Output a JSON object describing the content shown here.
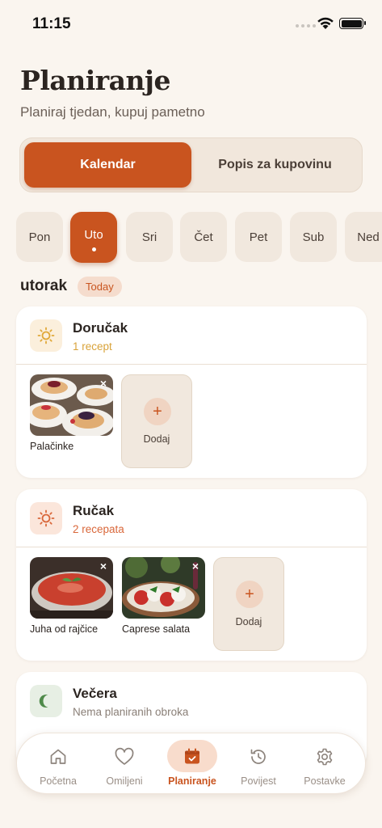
{
  "status_bar": {
    "time": "11:15"
  },
  "header": {
    "title": "Planiranje",
    "subtitle": "Planiraj tjedan, kupuj pametno"
  },
  "segmented": {
    "active": "Kalendar",
    "inactive": "Popis za kupovinu"
  },
  "days": [
    "Pon",
    "Uto",
    "Sri",
    "Čet",
    "Pet",
    "Sub",
    "Ned"
  ],
  "selected_day": {
    "name": "utorak",
    "badge": "Today"
  },
  "meals": {
    "breakfast": {
      "title": "Doručak",
      "count": "1 recept",
      "recipes": [
        "Palačinke"
      ],
      "add_label": "Dodaj"
    },
    "lunch": {
      "title": "Ručak",
      "count": "2 recepata",
      "recipes": [
        "Juha od rajčice",
        "Caprese salata"
      ],
      "add_label": "Dodaj"
    },
    "dinner": {
      "title": "Večera",
      "count": "Nema planiranih obroka"
    }
  },
  "colors": {
    "accent": "#c9541f",
    "background": "#faf5ef",
    "breakfast_count": "#d9a33a",
    "lunch_count": "#d9673a",
    "dinner_count": "#8a7f77"
  },
  "nav": {
    "items": [
      {
        "label": "Početna",
        "icon": "home-icon"
      },
      {
        "label": "Omiljeni",
        "icon": "heart-icon"
      },
      {
        "label": "Planiranje",
        "icon": "calendar-check-icon"
      },
      {
        "label": "Povijest",
        "icon": "history-icon"
      },
      {
        "label": "Postavke",
        "icon": "gear-icon"
      }
    ],
    "active": "Planiranje"
  }
}
